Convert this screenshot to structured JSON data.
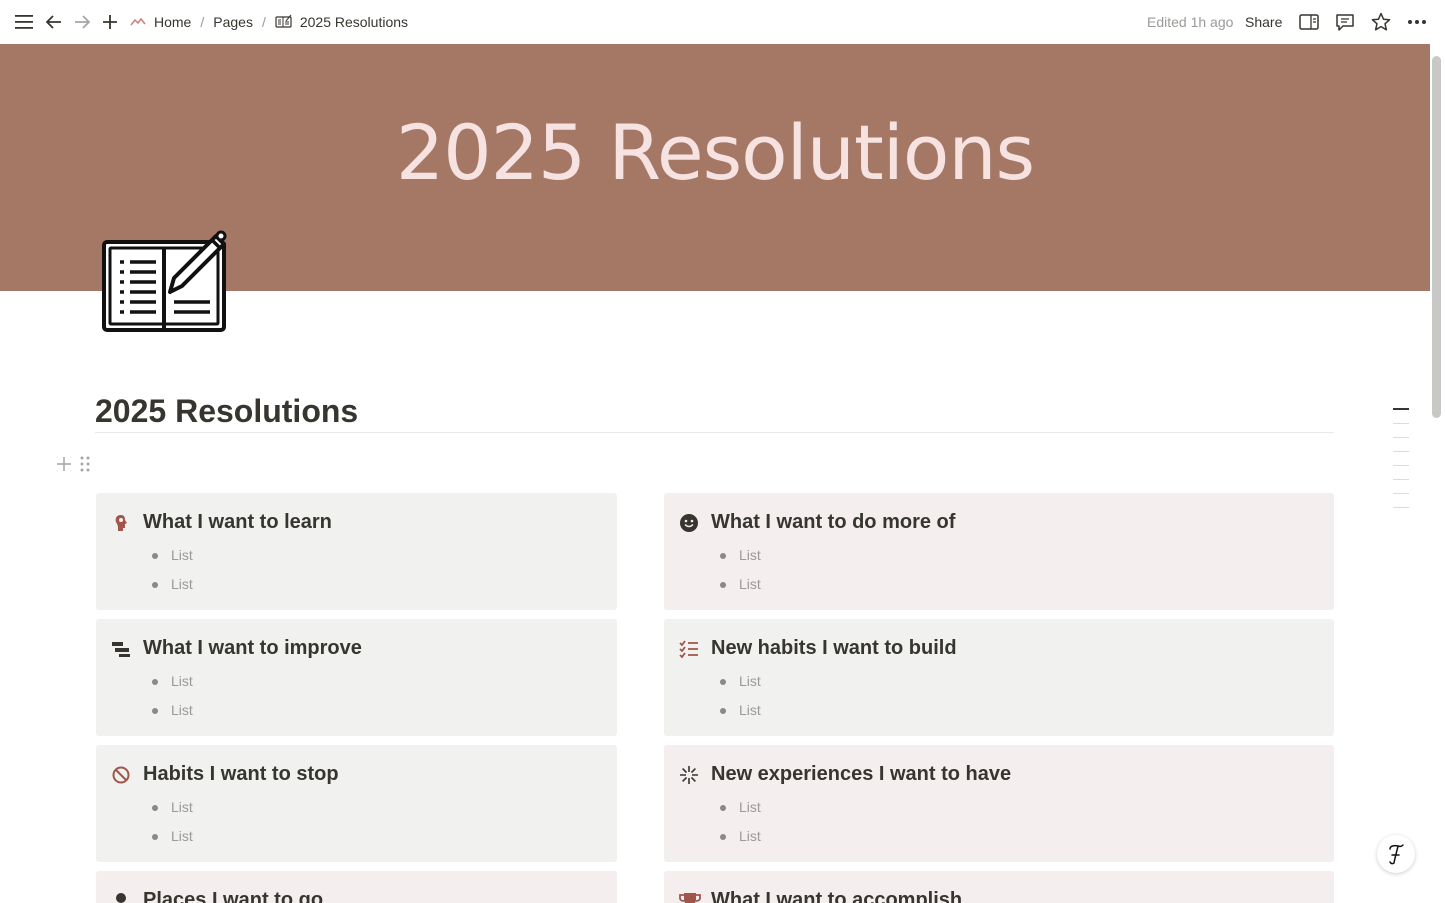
{
  "topbar": {
    "breadcrumbs": [
      "Home",
      "Pages",
      "2025 Resolutions"
    ],
    "separator": "/",
    "edited": "Edited 1h ago",
    "share_label": "Share"
  },
  "cover": {
    "title": "2025 Resolutions",
    "color": "#a57866",
    "title_color": "#f7e2e2"
  },
  "page": {
    "icon": "notebook-pencil-icon",
    "heading": "2025 Resolutions"
  },
  "cards": [
    {
      "icon": "brain-head-icon",
      "title": "What I want to learn",
      "items": [
        "List",
        "List"
      ]
    },
    {
      "icon": "smiley-icon",
      "title": "What I want to do more of",
      "items": [
        "List",
        "List"
      ]
    },
    {
      "icon": "stacked-bars-icon",
      "title": "What I want to improve",
      "items": [
        "List",
        "List"
      ]
    },
    {
      "icon": "checklist-icon",
      "title": "New habits I want to build",
      "items": [
        "List",
        "List"
      ]
    },
    {
      "icon": "prohibited-icon",
      "title": "Habits I want to stop",
      "items": [
        "List",
        "List"
      ]
    },
    {
      "icon": "sparkle-icon",
      "title": "New experiences I want to have",
      "items": [
        "List",
        "List"
      ]
    },
    {
      "icon": "pin-icon",
      "title": "Places I want to go",
      "items": []
    },
    {
      "icon": "trophy-icon",
      "title": "What I want to accomplish",
      "items": []
    }
  ],
  "help_button": "?",
  "accent": "#a0564a"
}
